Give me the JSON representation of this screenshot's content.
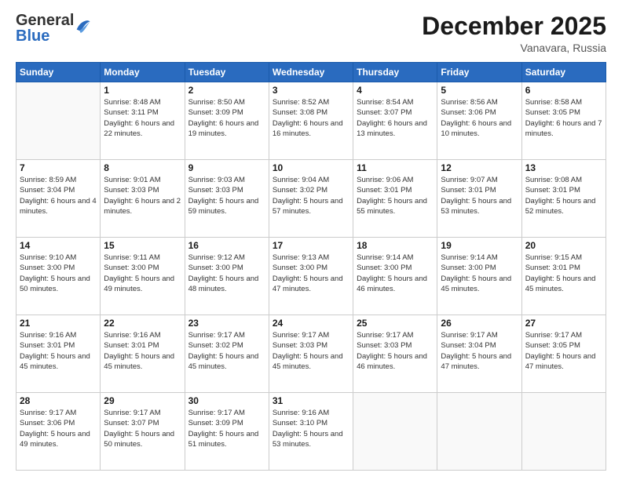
{
  "header": {
    "logo_general": "General",
    "logo_blue": "Blue",
    "month_title": "December 2025",
    "location": "Vanavara, Russia"
  },
  "days_of_week": [
    "Sunday",
    "Monday",
    "Tuesday",
    "Wednesday",
    "Thursday",
    "Friday",
    "Saturday"
  ],
  "weeks": [
    [
      {
        "day": "",
        "sunrise": "",
        "sunset": "",
        "daylight": ""
      },
      {
        "day": "1",
        "sunrise": "Sunrise: 8:48 AM",
        "sunset": "Sunset: 3:11 PM",
        "daylight": "Daylight: 6 hours and 22 minutes."
      },
      {
        "day": "2",
        "sunrise": "Sunrise: 8:50 AM",
        "sunset": "Sunset: 3:09 PM",
        "daylight": "Daylight: 6 hours and 19 minutes."
      },
      {
        "day": "3",
        "sunrise": "Sunrise: 8:52 AM",
        "sunset": "Sunset: 3:08 PM",
        "daylight": "Daylight: 6 hours and 16 minutes."
      },
      {
        "day": "4",
        "sunrise": "Sunrise: 8:54 AM",
        "sunset": "Sunset: 3:07 PM",
        "daylight": "Daylight: 6 hours and 13 minutes."
      },
      {
        "day": "5",
        "sunrise": "Sunrise: 8:56 AM",
        "sunset": "Sunset: 3:06 PM",
        "daylight": "Daylight: 6 hours and 10 minutes."
      },
      {
        "day": "6",
        "sunrise": "Sunrise: 8:58 AM",
        "sunset": "Sunset: 3:05 PM",
        "daylight": "Daylight: 6 hours and 7 minutes."
      }
    ],
    [
      {
        "day": "7",
        "sunrise": "Sunrise: 8:59 AM",
        "sunset": "Sunset: 3:04 PM",
        "daylight": "Daylight: 6 hours and 4 minutes."
      },
      {
        "day": "8",
        "sunrise": "Sunrise: 9:01 AM",
        "sunset": "Sunset: 3:03 PM",
        "daylight": "Daylight: 6 hours and 2 minutes."
      },
      {
        "day": "9",
        "sunrise": "Sunrise: 9:03 AM",
        "sunset": "Sunset: 3:03 PM",
        "daylight": "Daylight: 5 hours and 59 minutes."
      },
      {
        "day": "10",
        "sunrise": "Sunrise: 9:04 AM",
        "sunset": "Sunset: 3:02 PM",
        "daylight": "Daylight: 5 hours and 57 minutes."
      },
      {
        "day": "11",
        "sunrise": "Sunrise: 9:06 AM",
        "sunset": "Sunset: 3:01 PM",
        "daylight": "Daylight: 5 hours and 55 minutes."
      },
      {
        "day": "12",
        "sunrise": "Sunrise: 9:07 AM",
        "sunset": "Sunset: 3:01 PM",
        "daylight": "Daylight: 5 hours and 53 minutes."
      },
      {
        "day": "13",
        "sunrise": "Sunrise: 9:08 AM",
        "sunset": "Sunset: 3:01 PM",
        "daylight": "Daylight: 5 hours and 52 minutes."
      }
    ],
    [
      {
        "day": "14",
        "sunrise": "Sunrise: 9:10 AM",
        "sunset": "Sunset: 3:00 PM",
        "daylight": "Daylight: 5 hours and 50 minutes."
      },
      {
        "day": "15",
        "sunrise": "Sunrise: 9:11 AM",
        "sunset": "Sunset: 3:00 PM",
        "daylight": "Daylight: 5 hours and 49 minutes."
      },
      {
        "day": "16",
        "sunrise": "Sunrise: 9:12 AM",
        "sunset": "Sunset: 3:00 PM",
        "daylight": "Daylight: 5 hours and 48 minutes."
      },
      {
        "day": "17",
        "sunrise": "Sunrise: 9:13 AM",
        "sunset": "Sunset: 3:00 PM",
        "daylight": "Daylight: 5 hours and 47 minutes."
      },
      {
        "day": "18",
        "sunrise": "Sunrise: 9:14 AM",
        "sunset": "Sunset: 3:00 PM",
        "daylight": "Daylight: 5 hours and 46 minutes."
      },
      {
        "day": "19",
        "sunrise": "Sunrise: 9:14 AM",
        "sunset": "Sunset: 3:00 PM",
        "daylight": "Daylight: 5 hours and 45 minutes."
      },
      {
        "day": "20",
        "sunrise": "Sunrise: 9:15 AM",
        "sunset": "Sunset: 3:01 PM",
        "daylight": "Daylight: 5 hours and 45 minutes."
      }
    ],
    [
      {
        "day": "21",
        "sunrise": "Sunrise: 9:16 AM",
        "sunset": "Sunset: 3:01 PM",
        "daylight": "Daylight: 5 hours and 45 minutes."
      },
      {
        "day": "22",
        "sunrise": "Sunrise: 9:16 AM",
        "sunset": "Sunset: 3:01 PM",
        "daylight": "Daylight: 5 hours and 45 minutes."
      },
      {
        "day": "23",
        "sunrise": "Sunrise: 9:17 AM",
        "sunset": "Sunset: 3:02 PM",
        "daylight": "Daylight: 5 hours and 45 minutes."
      },
      {
        "day": "24",
        "sunrise": "Sunrise: 9:17 AM",
        "sunset": "Sunset: 3:03 PM",
        "daylight": "Daylight: 5 hours and 45 minutes."
      },
      {
        "day": "25",
        "sunrise": "Sunrise: 9:17 AM",
        "sunset": "Sunset: 3:03 PM",
        "daylight": "Daylight: 5 hours and 46 minutes."
      },
      {
        "day": "26",
        "sunrise": "Sunrise: 9:17 AM",
        "sunset": "Sunset: 3:04 PM",
        "daylight": "Daylight: 5 hours and 47 minutes."
      },
      {
        "day": "27",
        "sunrise": "Sunrise: 9:17 AM",
        "sunset": "Sunset: 3:05 PM",
        "daylight": "Daylight: 5 hours and 47 minutes."
      }
    ],
    [
      {
        "day": "28",
        "sunrise": "Sunrise: 9:17 AM",
        "sunset": "Sunset: 3:06 PM",
        "daylight": "Daylight: 5 hours and 49 minutes."
      },
      {
        "day": "29",
        "sunrise": "Sunrise: 9:17 AM",
        "sunset": "Sunset: 3:07 PM",
        "daylight": "Daylight: 5 hours and 50 minutes."
      },
      {
        "day": "30",
        "sunrise": "Sunrise: 9:17 AM",
        "sunset": "Sunset: 3:09 PM",
        "daylight": "Daylight: 5 hours and 51 minutes."
      },
      {
        "day": "31",
        "sunrise": "Sunrise: 9:16 AM",
        "sunset": "Sunset: 3:10 PM",
        "daylight": "Daylight: 5 hours and 53 minutes."
      },
      {
        "day": "",
        "sunrise": "",
        "sunset": "",
        "daylight": ""
      },
      {
        "day": "",
        "sunrise": "",
        "sunset": "",
        "daylight": ""
      },
      {
        "day": "",
        "sunrise": "",
        "sunset": "",
        "daylight": ""
      }
    ]
  ]
}
